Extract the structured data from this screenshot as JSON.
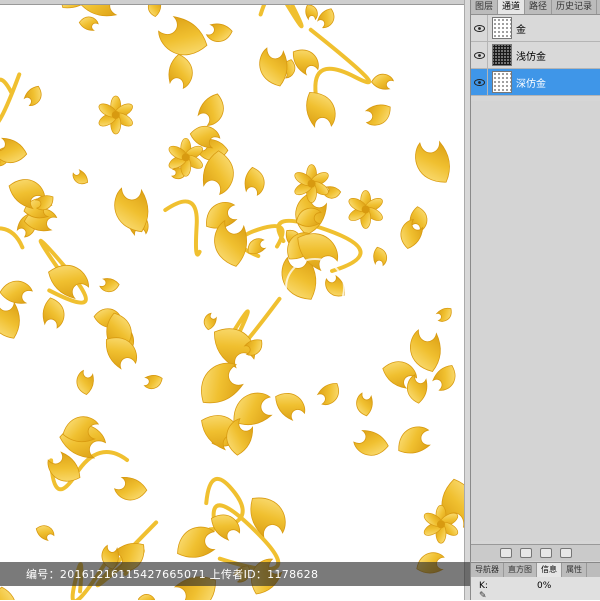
{
  "panel": {
    "tabs": [
      "图层",
      "通道",
      "路径",
      "历史记录"
    ],
    "active_tab": 1,
    "channels": [
      {
        "name": "金",
        "thumb": "noise",
        "selected": false
      },
      {
        "name": "浅仿金",
        "thumb": "qr",
        "selected": false
      },
      {
        "name": "深仿金",
        "thumb": "noise",
        "selected": true
      }
    ]
  },
  "info_panel": {
    "tabs": [
      "导航器",
      "直方图",
      "信息",
      "属性"
    ],
    "active_tab": 2,
    "k_label": "K:",
    "k_value": "0%"
  },
  "watermark": {
    "text": "编号：20161216115427665071 上传者ID：1178628"
  },
  "colors": {
    "gold_dark": "#d89a10",
    "gold_mid": "#f0c030",
    "gold_light": "#fde58a",
    "selection": "#3f96e8",
    "panel_bg": "#d6d6d6"
  },
  "icons": {
    "eye": "eye-icon",
    "pattern": "baroque-gold-floral"
  }
}
